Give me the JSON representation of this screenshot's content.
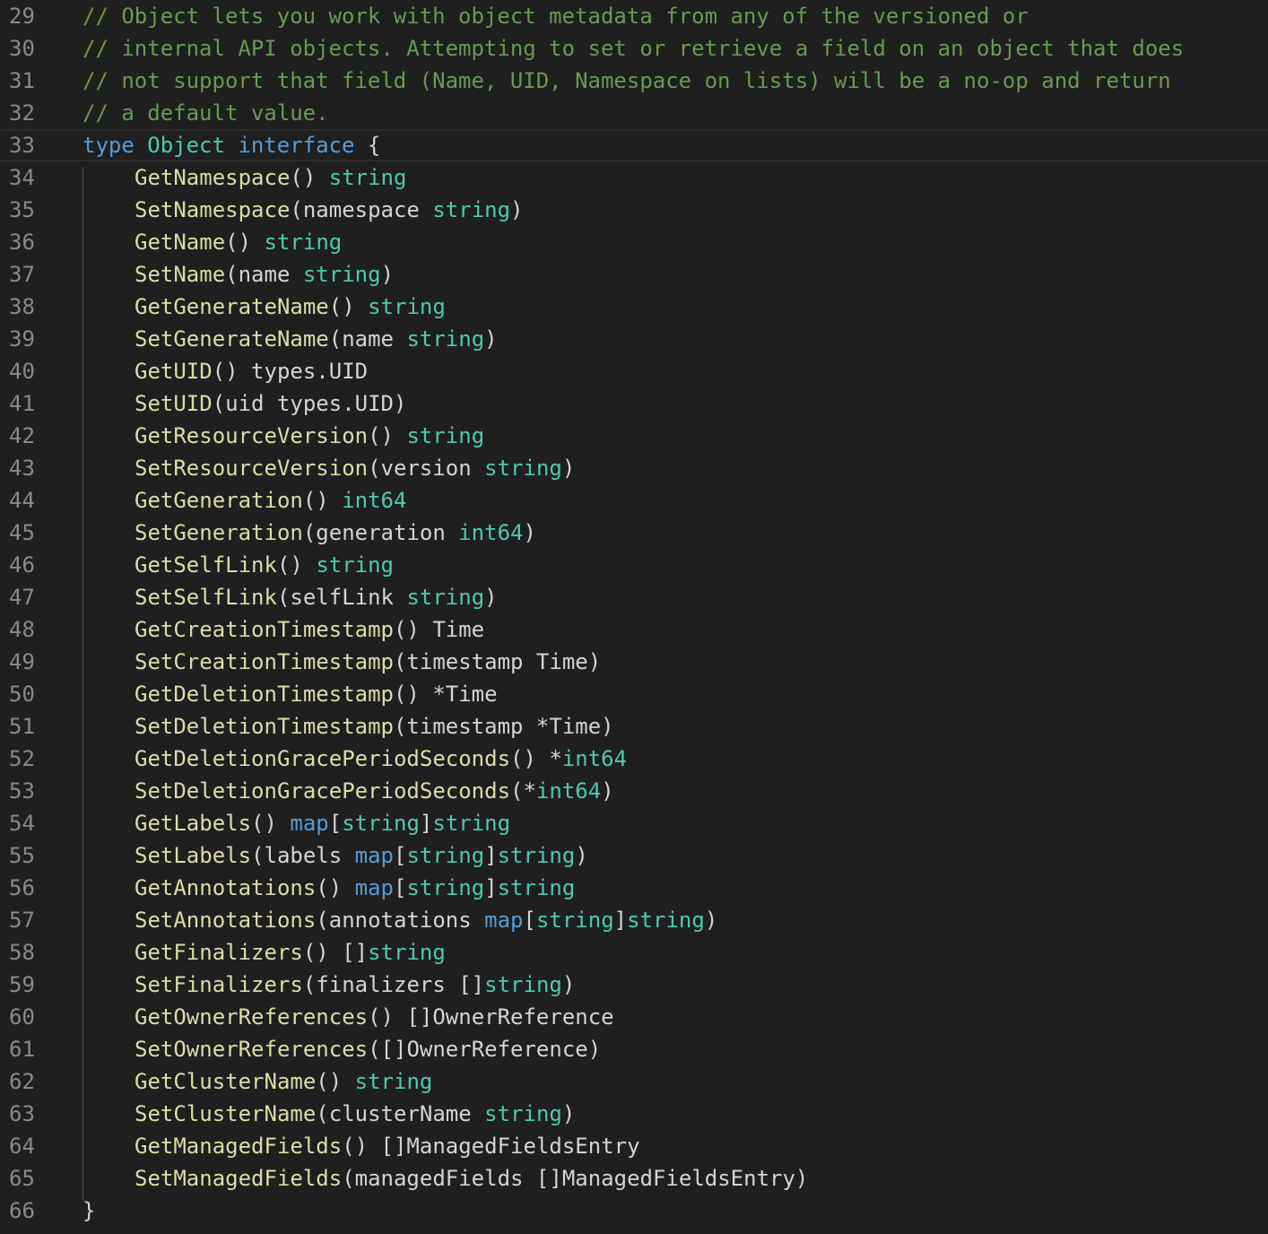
{
  "editor": {
    "language": "go",
    "colors": {
      "background": "#1f1f1f",
      "line_number": "#8a8a8a",
      "comment": "#6a9955",
      "keyword": "#569cd6",
      "type": "#4ec9b0",
      "function": "#dcdcaa",
      "plain": "#d4d4d4",
      "indent_guide": "#4a4a4a"
    },
    "lines": [
      {
        "n": "29",
        "indent": false,
        "tokens": [
          {
            "t": "// Object lets you work with object metadata from any of the versioned or",
            "c": "comment"
          }
        ]
      },
      {
        "n": "30",
        "indent": false,
        "tokens": [
          {
            "t": "// internal API objects. Attempting to set or retrieve a field on an object that does",
            "c": "comment"
          }
        ]
      },
      {
        "n": "31",
        "indent": false,
        "tokens": [
          {
            "t": "// not support that field (Name, UID, Namespace on lists) will be a no-op and return",
            "c": "comment"
          }
        ]
      },
      {
        "n": "32",
        "indent": false,
        "tokens": [
          {
            "t": "// a default value.",
            "c": "comment"
          }
        ]
      },
      {
        "n": "33",
        "indent": false,
        "current": true,
        "tokens": [
          {
            "t": "type",
            "c": "keyword"
          },
          {
            "t": " ",
            "c": "plain"
          },
          {
            "t": "Object",
            "c": "type"
          },
          {
            "t": " ",
            "c": "plain"
          },
          {
            "t": "interface",
            "c": "keyword"
          },
          {
            "t": " {",
            "c": "plain"
          }
        ]
      },
      {
        "n": "34",
        "indent": true,
        "tokens": [
          {
            "t": "GetNamespace",
            "c": "func"
          },
          {
            "t": "() ",
            "c": "plain"
          },
          {
            "t": "string",
            "c": "type"
          }
        ]
      },
      {
        "n": "35",
        "indent": true,
        "tokens": [
          {
            "t": "SetNamespace",
            "c": "func"
          },
          {
            "t": "(namespace ",
            "c": "plain"
          },
          {
            "t": "string",
            "c": "type"
          },
          {
            "t": ")",
            "c": "plain"
          }
        ]
      },
      {
        "n": "36",
        "indent": true,
        "tokens": [
          {
            "t": "GetName",
            "c": "func"
          },
          {
            "t": "() ",
            "c": "plain"
          },
          {
            "t": "string",
            "c": "type"
          }
        ]
      },
      {
        "n": "37",
        "indent": true,
        "tokens": [
          {
            "t": "SetName",
            "c": "func"
          },
          {
            "t": "(name ",
            "c": "plain"
          },
          {
            "t": "string",
            "c": "type"
          },
          {
            "t": ")",
            "c": "plain"
          }
        ]
      },
      {
        "n": "38",
        "indent": true,
        "tokens": [
          {
            "t": "GetGenerateName",
            "c": "func"
          },
          {
            "t": "() ",
            "c": "plain"
          },
          {
            "t": "string",
            "c": "type"
          }
        ]
      },
      {
        "n": "39",
        "indent": true,
        "tokens": [
          {
            "t": "SetGenerateName",
            "c": "func"
          },
          {
            "t": "(name ",
            "c": "plain"
          },
          {
            "t": "string",
            "c": "type"
          },
          {
            "t": ")",
            "c": "plain"
          }
        ]
      },
      {
        "n": "40",
        "indent": true,
        "tokens": [
          {
            "t": "GetUID",
            "c": "func"
          },
          {
            "t": "() types.UID",
            "c": "plain"
          }
        ]
      },
      {
        "n": "41",
        "indent": true,
        "tokens": [
          {
            "t": "SetUID",
            "c": "func"
          },
          {
            "t": "(uid types.UID)",
            "c": "plain"
          }
        ]
      },
      {
        "n": "42",
        "indent": true,
        "tokens": [
          {
            "t": "GetResourceVersion",
            "c": "func"
          },
          {
            "t": "() ",
            "c": "plain"
          },
          {
            "t": "string",
            "c": "type"
          }
        ]
      },
      {
        "n": "43",
        "indent": true,
        "tokens": [
          {
            "t": "SetResourceVersion",
            "c": "func"
          },
          {
            "t": "(version ",
            "c": "plain"
          },
          {
            "t": "string",
            "c": "type"
          },
          {
            "t": ")",
            "c": "plain"
          }
        ]
      },
      {
        "n": "44",
        "indent": true,
        "tokens": [
          {
            "t": "GetGeneration",
            "c": "func"
          },
          {
            "t": "() ",
            "c": "plain"
          },
          {
            "t": "int64",
            "c": "type"
          }
        ]
      },
      {
        "n": "45",
        "indent": true,
        "tokens": [
          {
            "t": "SetGeneration",
            "c": "func"
          },
          {
            "t": "(generation ",
            "c": "plain"
          },
          {
            "t": "int64",
            "c": "type"
          },
          {
            "t": ")",
            "c": "plain"
          }
        ]
      },
      {
        "n": "46",
        "indent": true,
        "tokens": [
          {
            "t": "GetSelfLink",
            "c": "func"
          },
          {
            "t": "() ",
            "c": "plain"
          },
          {
            "t": "string",
            "c": "type"
          }
        ]
      },
      {
        "n": "47",
        "indent": true,
        "tokens": [
          {
            "t": "SetSelfLink",
            "c": "func"
          },
          {
            "t": "(selfLink ",
            "c": "plain"
          },
          {
            "t": "string",
            "c": "type"
          },
          {
            "t": ")",
            "c": "plain"
          }
        ]
      },
      {
        "n": "48",
        "indent": true,
        "tokens": [
          {
            "t": "GetCreationTimestamp",
            "c": "func"
          },
          {
            "t": "() Time",
            "c": "plain"
          }
        ]
      },
      {
        "n": "49",
        "indent": true,
        "tokens": [
          {
            "t": "SetCreationTimestamp",
            "c": "func"
          },
          {
            "t": "(timestamp Time)",
            "c": "plain"
          }
        ]
      },
      {
        "n": "50",
        "indent": true,
        "tokens": [
          {
            "t": "GetDeletionTimestamp",
            "c": "func"
          },
          {
            "t": "() *Time",
            "c": "plain"
          }
        ]
      },
      {
        "n": "51",
        "indent": true,
        "tokens": [
          {
            "t": "SetDeletionTimestamp",
            "c": "func"
          },
          {
            "t": "(timestamp *Time)",
            "c": "plain"
          }
        ]
      },
      {
        "n": "52",
        "indent": true,
        "tokens": [
          {
            "t": "GetDeletionGracePeriodSeconds",
            "c": "func"
          },
          {
            "t": "() *",
            "c": "plain"
          },
          {
            "t": "int64",
            "c": "type"
          }
        ]
      },
      {
        "n": "53",
        "indent": true,
        "tokens": [
          {
            "t": "SetDeletionGracePeriodSeconds",
            "c": "func"
          },
          {
            "t": "(*",
            "c": "plain"
          },
          {
            "t": "int64",
            "c": "type"
          },
          {
            "t": ")",
            "c": "plain"
          }
        ]
      },
      {
        "n": "54",
        "indent": true,
        "tokens": [
          {
            "t": "GetLabels",
            "c": "func"
          },
          {
            "t": "() ",
            "c": "plain"
          },
          {
            "t": "map",
            "c": "keyword"
          },
          {
            "t": "[",
            "c": "plain"
          },
          {
            "t": "string",
            "c": "type"
          },
          {
            "t": "]",
            "c": "plain"
          },
          {
            "t": "string",
            "c": "type"
          }
        ]
      },
      {
        "n": "55",
        "indent": true,
        "tokens": [
          {
            "t": "SetLabels",
            "c": "func"
          },
          {
            "t": "(labels ",
            "c": "plain"
          },
          {
            "t": "map",
            "c": "keyword"
          },
          {
            "t": "[",
            "c": "plain"
          },
          {
            "t": "string",
            "c": "type"
          },
          {
            "t": "]",
            "c": "plain"
          },
          {
            "t": "string",
            "c": "type"
          },
          {
            "t": ")",
            "c": "plain"
          }
        ]
      },
      {
        "n": "56",
        "indent": true,
        "tokens": [
          {
            "t": "GetAnnotations",
            "c": "func"
          },
          {
            "t": "() ",
            "c": "plain"
          },
          {
            "t": "map",
            "c": "keyword"
          },
          {
            "t": "[",
            "c": "plain"
          },
          {
            "t": "string",
            "c": "type"
          },
          {
            "t": "]",
            "c": "plain"
          },
          {
            "t": "string",
            "c": "type"
          }
        ]
      },
      {
        "n": "57",
        "indent": true,
        "tokens": [
          {
            "t": "SetAnnotations",
            "c": "func"
          },
          {
            "t": "(annotations ",
            "c": "plain"
          },
          {
            "t": "map",
            "c": "keyword"
          },
          {
            "t": "[",
            "c": "plain"
          },
          {
            "t": "string",
            "c": "type"
          },
          {
            "t": "]",
            "c": "plain"
          },
          {
            "t": "string",
            "c": "type"
          },
          {
            "t": ")",
            "c": "plain"
          }
        ]
      },
      {
        "n": "58",
        "indent": true,
        "tokens": [
          {
            "t": "GetFinalizers",
            "c": "func"
          },
          {
            "t": "() []",
            "c": "plain"
          },
          {
            "t": "string",
            "c": "type"
          }
        ]
      },
      {
        "n": "59",
        "indent": true,
        "tokens": [
          {
            "t": "SetFinalizers",
            "c": "func"
          },
          {
            "t": "(finalizers []",
            "c": "plain"
          },
          {
            "t": "string",
            "c": "type"
          },
          {
            "t": ")",
            "c": "plain"
          }
        ]
      },
      {
        "n": "60",
        "indent": true,
        "tokens": [
          {
            "t": "GetOwnerReferences",
            "c": "func"
          },
          {
            "t": "() []OwnerReference",
            "c": "plain"
          }
        ]
      },
      {
        "n": "61",
        "indent": true,
        "tokens": [
          {
            "t": "SetOwnerReferences",
            "c": "func"
          },
          {
            "t": "([]OwnerReference)",
            "c": "plain"
          }
        ]
      },
      {
        "n": "62",
        "indent": true,
        "tokens": [
          {
            "t": "GetClusterName",
            "c": "func"
          },
          {
            "t": "() ",
            "c": "plain"
          },
          {
            "t": "string",
            "c": "type"
          }
        ]
      },
      {
        "n": "63",
        "indent": true,
        "tokens": [
          {
            "t": "SetClusterName",
            "c": "func"
          },
          {
            "t": "(clusterName ",
            "c": "plain"
          },
          {
            "t": "string",
            "c": "type"
          },
          {
            "t": ")",
            "c": "plain"
          }
        ]
      },
      {
        "n": "64",
        "indent": true,
        "tokens": [
          {
            "t": "GetManagedFields",
            "c": "func"
          },
          {
            "t": "() []ManagedFieldsEntry",
            "c": "plain"
          }
        ]
      },
      {
        "n": "65",
        "indent": true,
        "tokens": [
          {
            "t": "SetManagedFields",
            "c": "func"
          },
          {
            "t": "(managedFields []ManagedFieldsEntry)",
            "c": "plain"
          }
        ]
      },
      {
        "n": "66",
        "indent": false,
        "tokens": [
          {
            "t": "}",
            "c": "plain"
          }
        ]
      }
    ]
  }
}
